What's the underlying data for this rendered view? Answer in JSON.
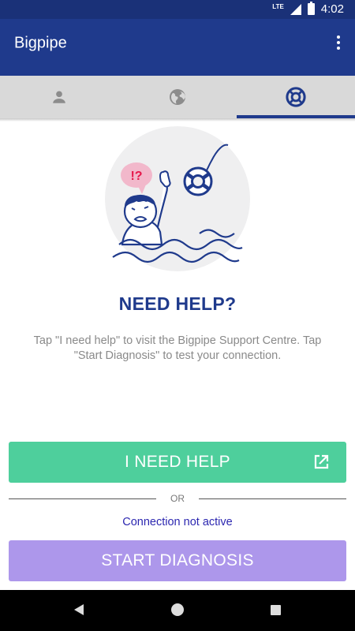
{
  "status": {
    "network": "LTE",
    "time": "4:02"
  },
  "app": {
    "title": "Bigpipe"
  },
  "tabs": [
    {
      "icon": "person-icon",
      "active": false
    },
    {
      "icon": "globe-icon",
      "active": false
    },
    {
      "icon": "lifebuoy-icon",
      "active": true
    }
  ],
  "illustration": {
    "speech": "!?"
  },
  "main": {
    "title": "NEED HELP?",
    "description": "Tap \"I need help\" to visit the Bigpipe Support Centre. Tap \"Start Diagnosis\" to test your connection.",
    "help_button": "I NEED HELP",
    "or_label": "OR",
    "connection_status": "Connection not active",
    "diagnosis_button": "START DIAGNOSIS"
  },
  "colors": {
    "primary": "#1f3a8c",
    "status_bar": "#1a3178",
    "help_button": "#4ecf9c",
    "diagnosis_button": "#ad97eb",
    "connection_text": "#2c27b0"
  }
}
